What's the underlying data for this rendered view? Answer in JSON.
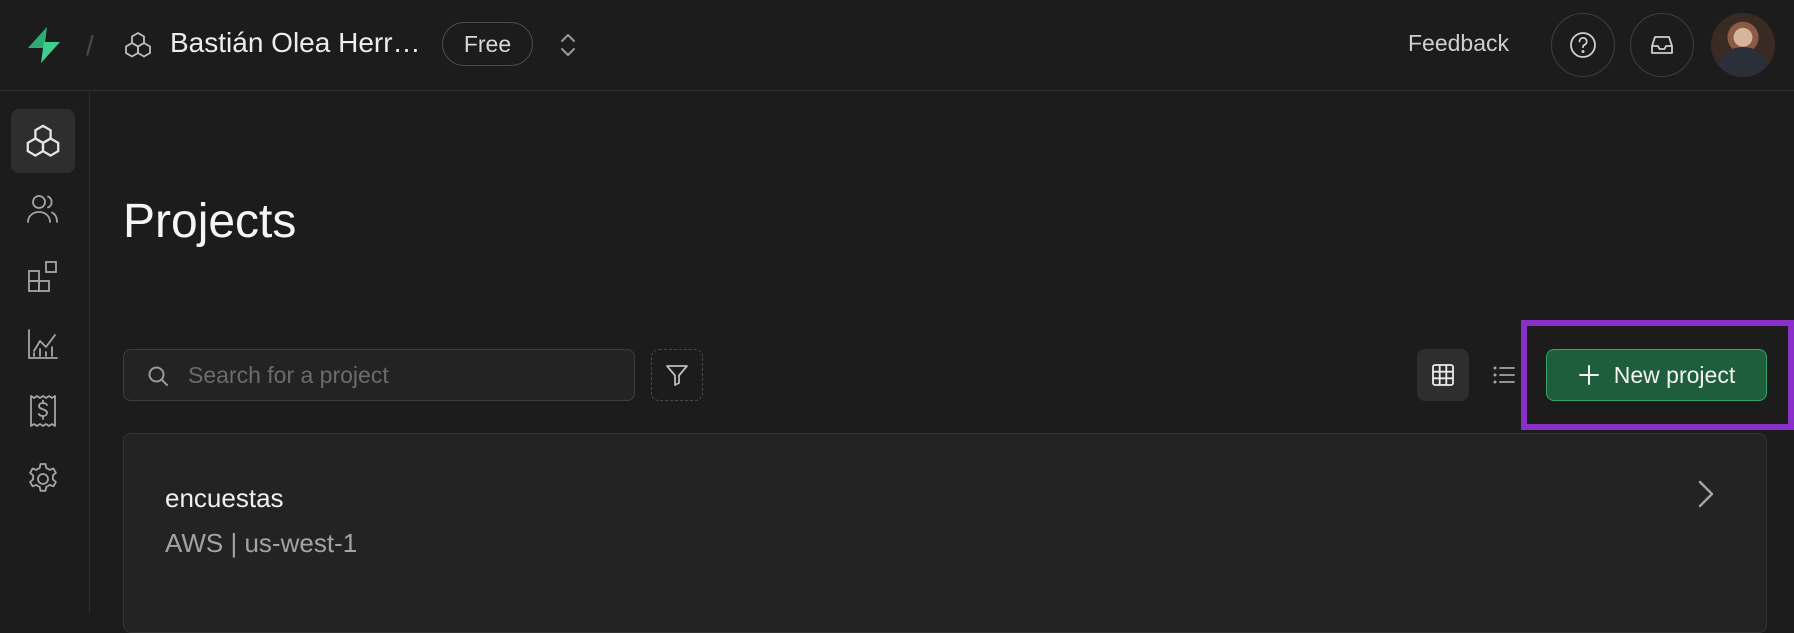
{
  "header": {
    "org_name": "Bastián Olea Herr…",
    "plan_badge": "Free",
    "feedback_label": "Feedback"
  },
  "main": {
    "title": "Projects",
    "search": {
      "placeholder": "Search for a project",
      "value": ""
    },
    "new_project_label": "New project"
  },
  "projects": [
    {
      "name": "encuestas",
      "region": "AWS | us-west-1"
    }
  ],
  "colors": {
    "brand_green": "#3ecf8e",
    "button_green": "#1f5e3a",
    "highlight_purple": "#8b2fc9",
    "background": "#1c1c1c"
  },
  "icons": {
    "sidebar": [
      "projects-icon",
      "team-icon",
      "integrations-icon",
      "usage-icon",
      "billing-icon",
      "settings-icon"
    ],
    "toolbar": [
      "search-icon",
      "filter-icon",
      "grid-view-icon",
      "list-view-icon",
      "plus-icon"
    ],
    "header": [
      "supabase-logo-icon",
      "org-icon",
      "chevrons-up-down-icon",
      "help-icon",
      "inbox-icon"
    ]
  }
}
